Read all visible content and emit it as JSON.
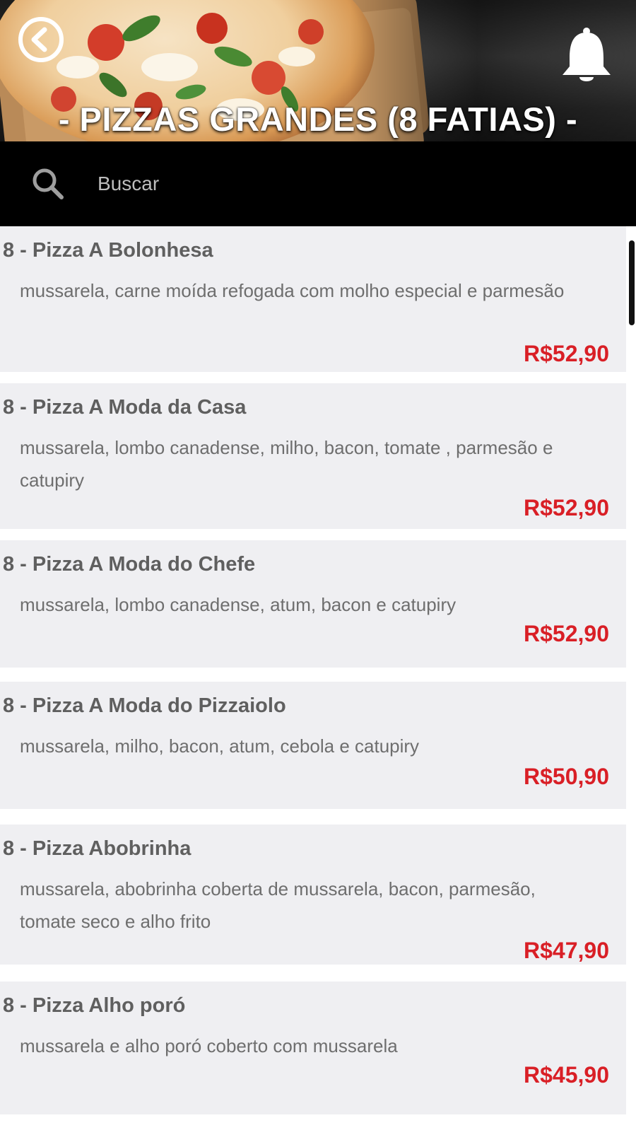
{
  "header": {
    "title": "- PIZZAS GRANDES (8 FATIAS) -",
    "back_icon": "chevron-left-circle-icon",
    "bell_icon": "bell-icon"
  },
  "search": {
    "placeholder": "Buscar",
    "value": "",
    "icon": "search-icon"
  },
  "products": [
    {
      "name": "8 - Pizza A Bolonhesa",
      "description": "mussarela, carne moída refogada com molho especial e parmesão",
      "price": "R$52,90"
    },
    {
      "name": "8 - Pizza A Moda da Casa",
      "description": "mussarela, lombo canadense, milho, bacon, tomate , parmesão e catupiry",
      "price": "R$52,90"
    },
    {
      "name": "8 - Pizza A Moda do Chefe",
      "description": "mussarela, lombo canadense, atum, bacon e catupiry",
      "price": "R$52,90"
    },
    {
      "name": "8 - Pizza A Moda do Pizzaiolo",
      "description": "mussarela, milho, bacon, atum, cebola e catupiry",
      "price": "R$50,90"
    },
    {
      "name": "8 - Pizza Abobrinha",
      "description": "mussarela, abobrinha coberta de mussarela, bacon, parmesão, tomate seco e alho frito",
      "price": "R$47,90"
    },
    {
      "name": "8 - Pizza Alho poró",
      "description": "mussarela e alho poró coberto com mussarela",
      "price": "R$45,90"
    }
  ],
  "colors": {
    "price": "#d91f26",
    "card_background": "#efeff2",
    "search_bar": "#000000",
    "title_text": "#ffffff"
  }
}
